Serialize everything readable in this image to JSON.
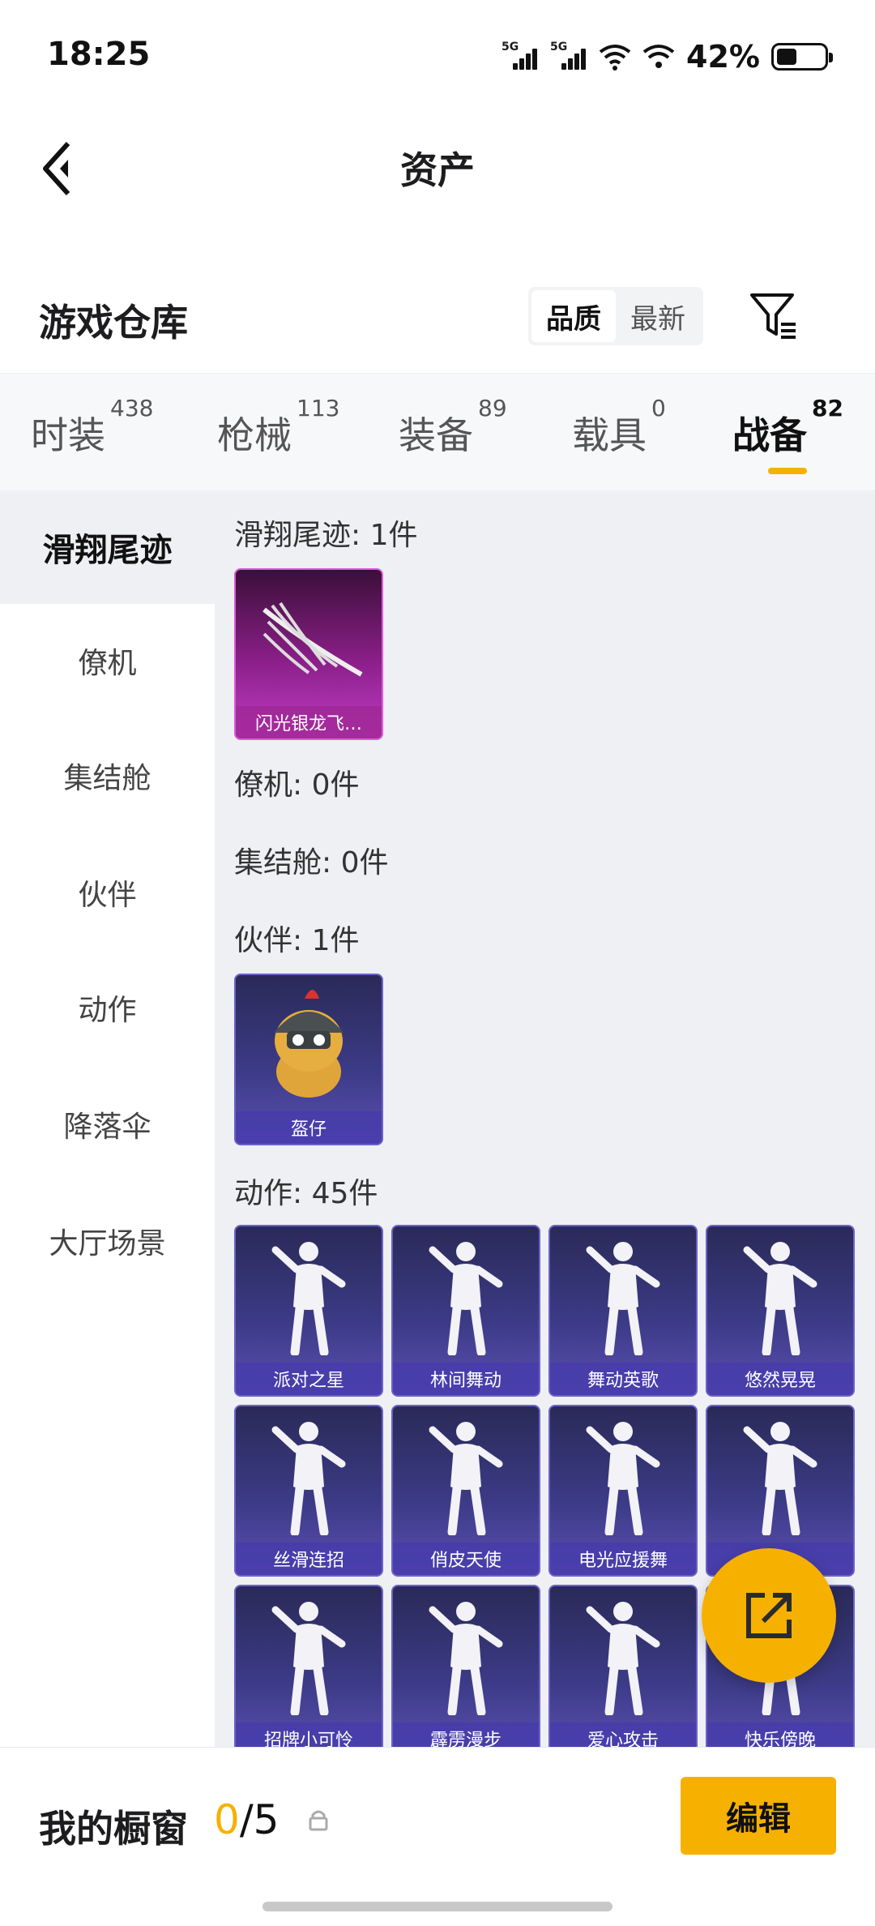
{
  "status": {
    "time": "18:25",
    "battery": "42%",
    "battery_level": 0.42,
    "net1": "5G",
    "net2": "5G"
  },
  "header": {
    "title": "资产"
  },
  "warehouse": {
    "title": "游戏仓库",
    "sort_options": [
      "品质",
      "最新"
    ],
    "active_sort": "品质"
  },
  "tabs": [
    {
      "label": "时装",
      "count": "438"
    },
    {
      "label": "枪械",
      "count": "113"
    },
    {
      "label": "装备",
      "count": "89"
    },
    {
      "label": "载具",
      "count": "0"
    },
    {
      "label": "战备",
      "count": "82"
    }
  ],
  "active_tab": "战备",
  "side_menu": [
    "滑翔尾迹",
    "僚机",
    "集结舱",
    "伙伴",
    "动作",
    "降落伞",
    "大厅场景"
  ],
  "active_side": "滑翔尾迹",
  "sections": {
    "glide": {
      "title": "滑翔尾迹: 1件",
      "items": [
        "闪光银龙飞…"
      ]
    },
    "wingman": {
      "title": "僚机: 0件"
    },
    "pod": {
      "title": "集结舱: 0件"
    },
    "partner": {
      "title": "伙伴: 1件",
      "items": [
        "盔仔"
      ]
    },
    "emote": {
      "title": "动作: 45件",
      "items": [
        "派对之星",
        "林间舞动",
        "舞动英歌",
        "悠然晃晃",
        "丝滑连招",
        "俏皮天使",
        "电光应援舞",
        "",
        "招牌小可怜",
        "霹雳漫步",
        "爱心攻击",
        "快乐傍晚"
      ]
    }
  },
  "bottom": {
    "label": "我的橱窗",
    "current": "0",
    "total": "/5",
    "edit": "编辑"
  },
  "colors": {
    "accent": "#f6b100",
    "card_purple": "#3b3a85",
    "card_pink": "#8c1f8a"
  }
}
